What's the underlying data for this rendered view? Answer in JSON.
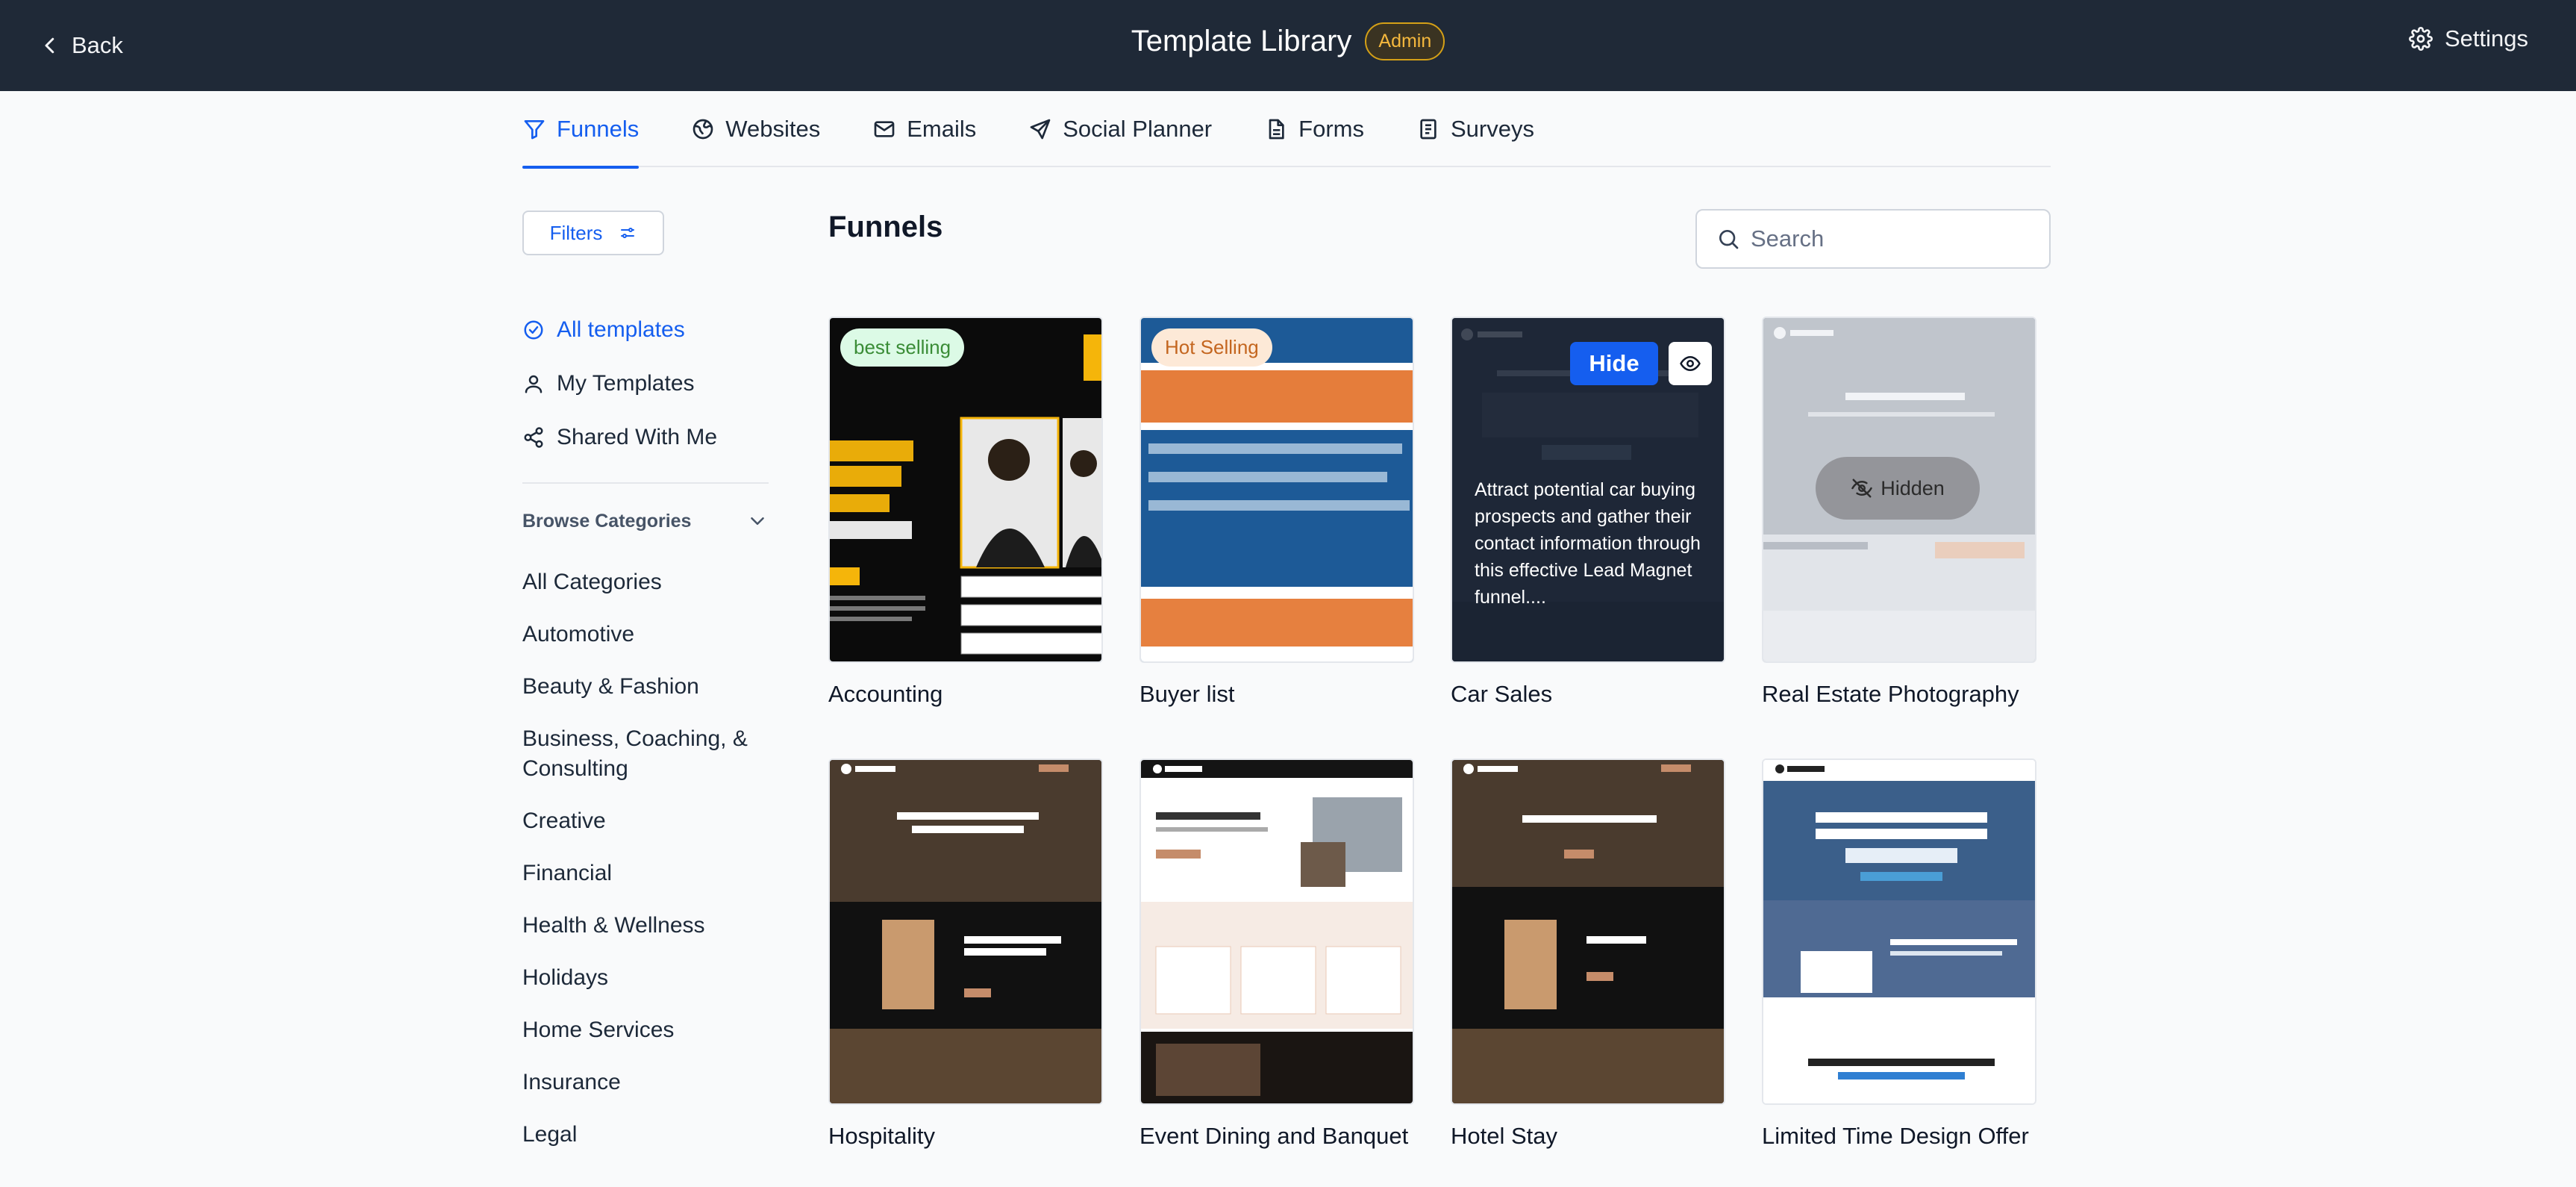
{
  "header": {
    "back_label": "Back",
    "title": "Template Library",
    "badge": "Admin",
    "settings_label": "Settings"
  },
  "tabs": [
    {
      "label": "Funnels",
      "icon": "funnel-icon",
      "active": true
    },
    {
      "label": "Websites",
      "icon": "globe-icon"
    },
    {
      "label": "Emails",
      "icon": "mail-icon"
    },
    {
      "label": "Social Planner",
      "icon": "send-icon"
    },
    {
      "label": "Forms",
      "icon": "document-icon"
    },
    {
      "label": "Surveys",
      "icon": "clipboard-icon"
    }
  ],
  "sidebar": {
    "filters_label": "Filters",
    "nav": [
      {
        "label": "All templates",
        "icon": "check-circle-icon",
        "active": true
      },
      {
        "label": "My Templates",
        "icon": "user-icon"
      },
      {
        "label": "Shared With Me",
        "icon": "share-icon"
      }
    ],
    "browse_label": "Browse Categories",
    "categories": [
      "All Categories",
      "Automotive",
      "Beauty & Fashion",
      "Business, Coaching, & Consulting",
      "Creative",
      "Financial",
      "Health & Wellness",
      "Holidays",
      "Home Services",
      "Insurance",
      "Legal"
    ]
  },
  "main": {
    "title": "Funnels",
    "search_placeholder": "Search"
  },
  "templates": [
    {
      "name": "Accounting",
      "badge": "best selling"
    },
    {
      "name": "Buyer list",
      "badge": "Hot Selling"
    },
    {
      "name": "Car Sales",
      "hide_label": "Hide",
      "description": "Attract potential car buying prospects and gather their contact information through this effective Lead Magnet funnel...."
    },
    {
      "name": "Real Estate Photography",
      "hidden_label": "Hidden"
    },
    {
      "name": "Hospitality"
    },
    {
      "name": "Event Dining and Banquet"
    },
    {
      "name": "Hotel Stay"
    },
    {
      "name": "Limited Time Design Offer"
    }
  ],
  "colors": {
    "header_bg": "#1f2937",
    "accent": "#155eef",
    "admin_badge": "#d4a017"
  }
}
